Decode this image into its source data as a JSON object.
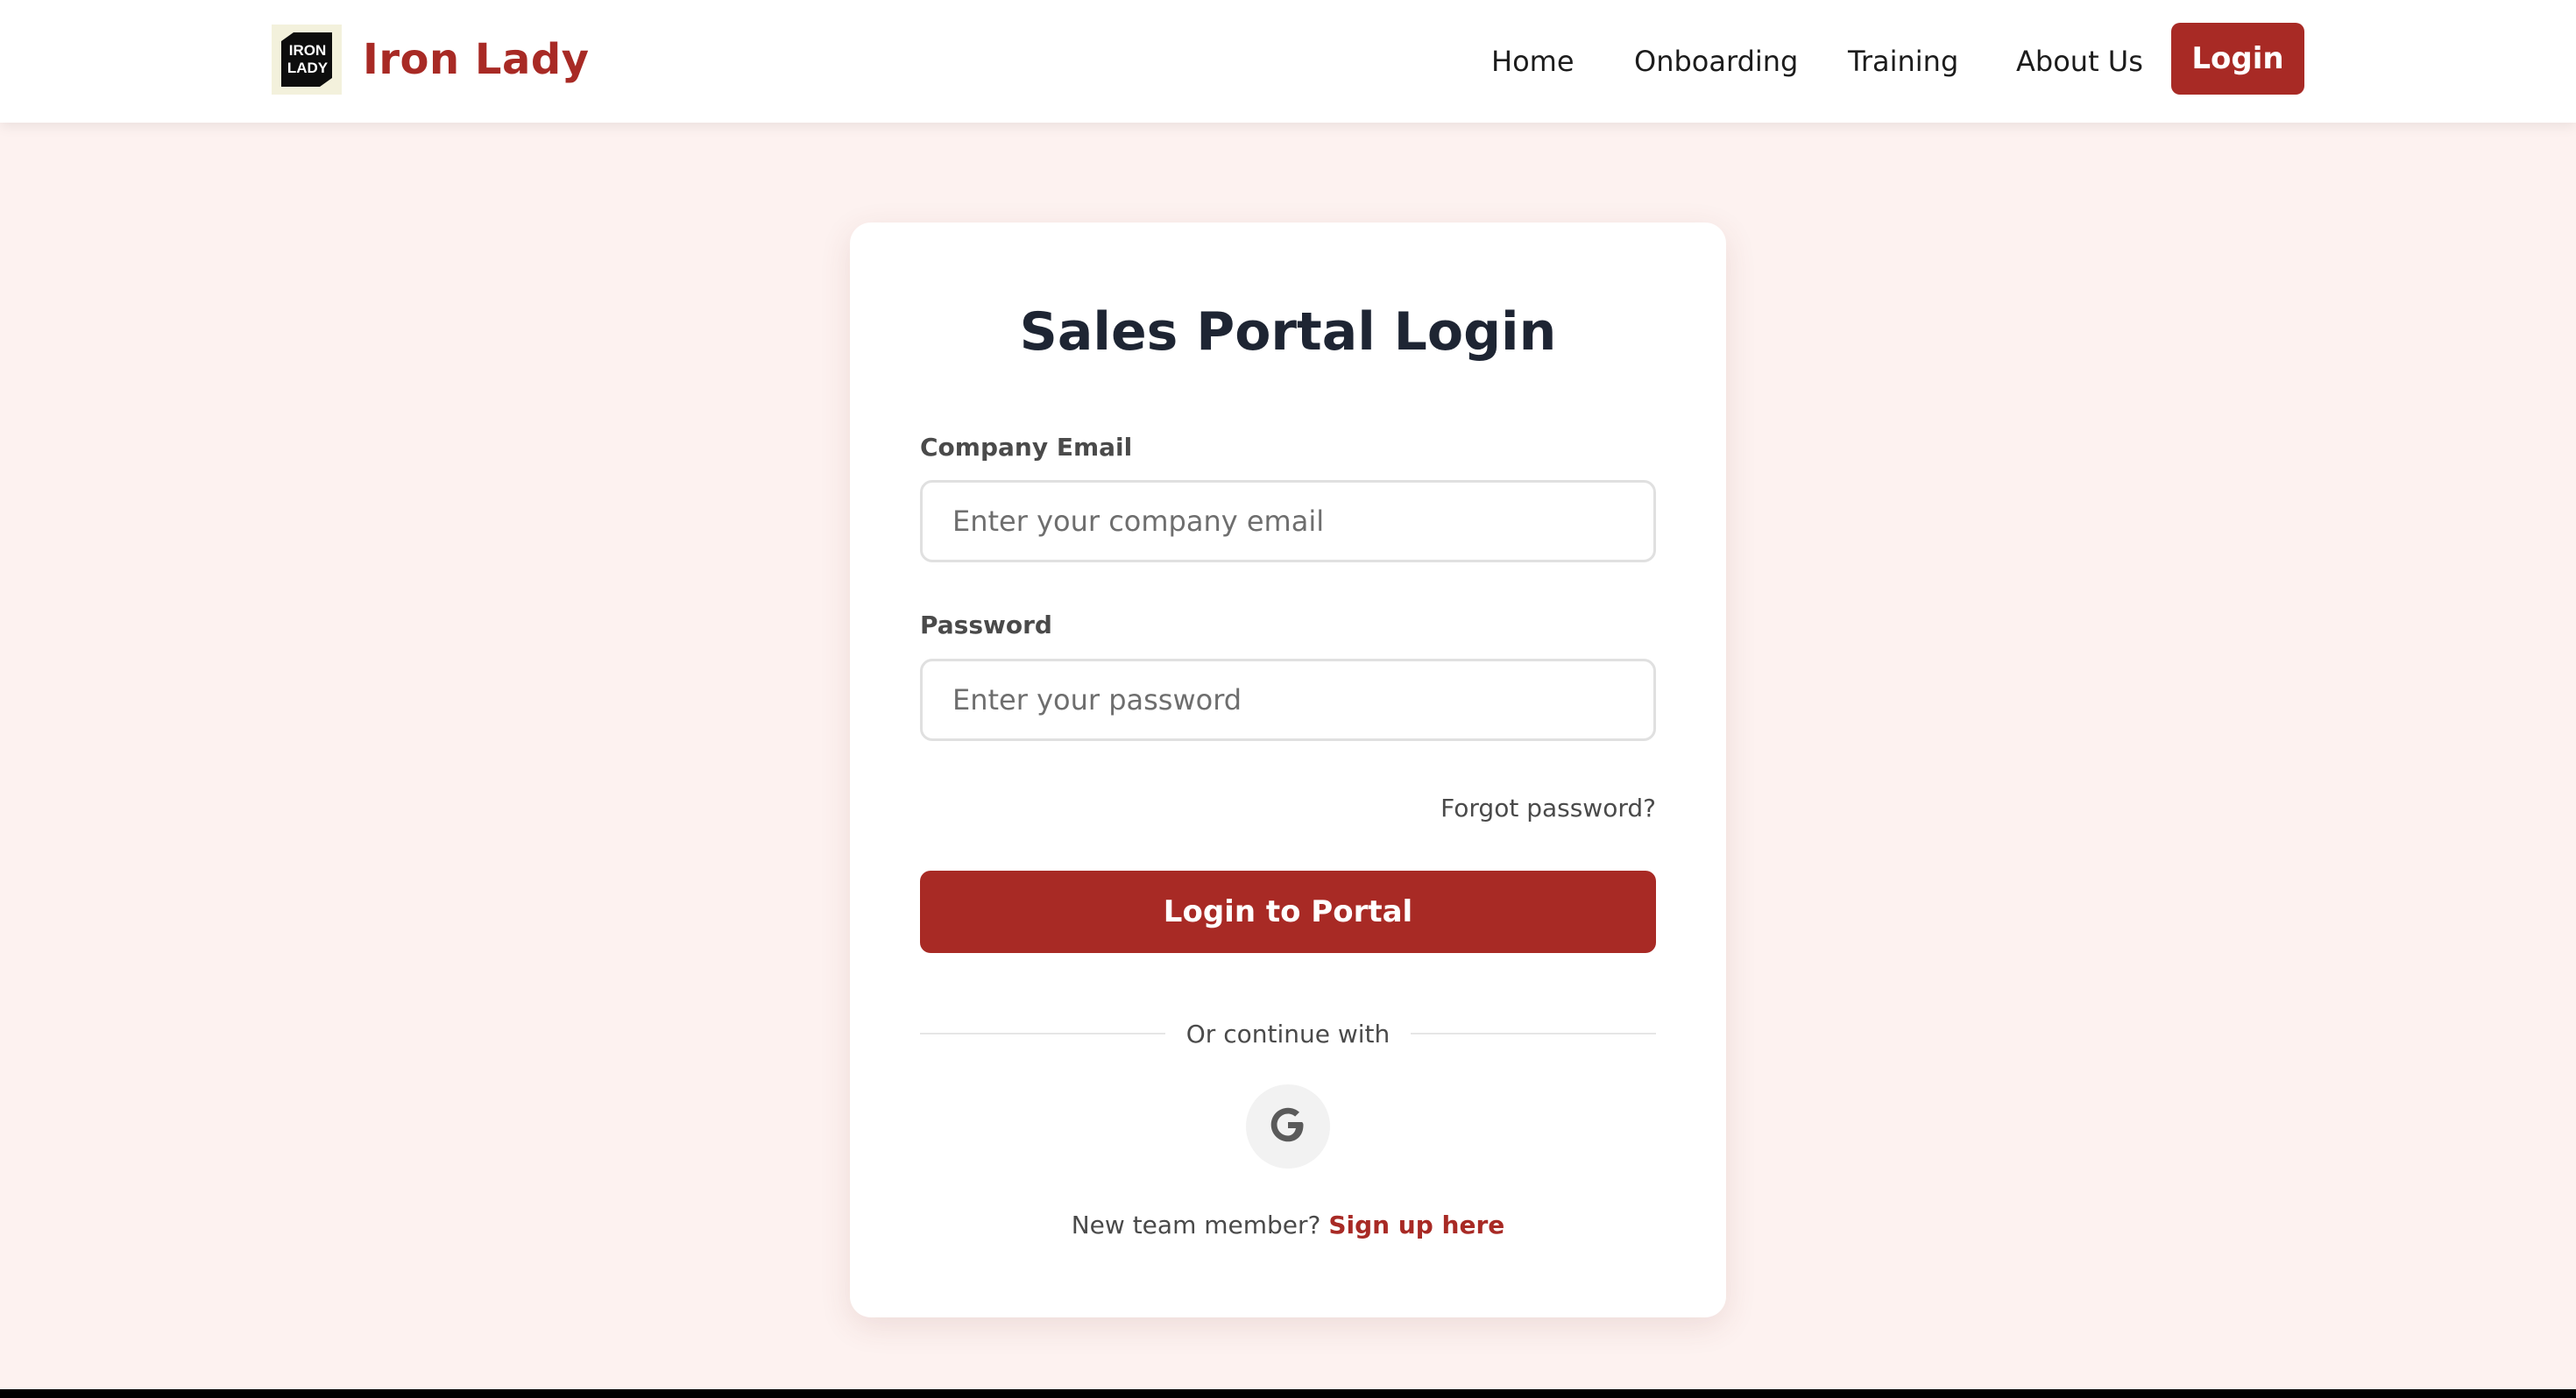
{
  "brand": {
    "name": "Iron Lady",
    "logo_text_top": "IRON",
    "logo_text_bottom": "LADY",
    "accent_color": "#a82a25"
  },
  "nav": {
    "items": [
      {
        "label": "Home"
      },
      {
        "label": "Onboarding"
      },
      {
        "label": "Training"
      },
      {
        "label": "About Us"
      }
    ],
    "login_label": "Login"
  },
  "form": {
    "title": "Sales Portal Login",
    "email_label": "Company Email",
    "email_placeholder": "Enter your company email",
    "email_value": "",
    "password_label": "Password",
    "password_placeholder": "Enter your password",
    "password_value": "",
    "forgot_label": "Forgot password?",
    "submit_label": "Login to Portal",
    "divider_text": "Or continue with",
    "social_icon": "google-icon",
    "signup_prompt": "New team member?",
    "signup_link": "Sign up here"
  },
  "colors": {
    "background": "#fdf2f0",
    "primary": "#a82a25",
    "heading": "#1e2533"
  }
}
